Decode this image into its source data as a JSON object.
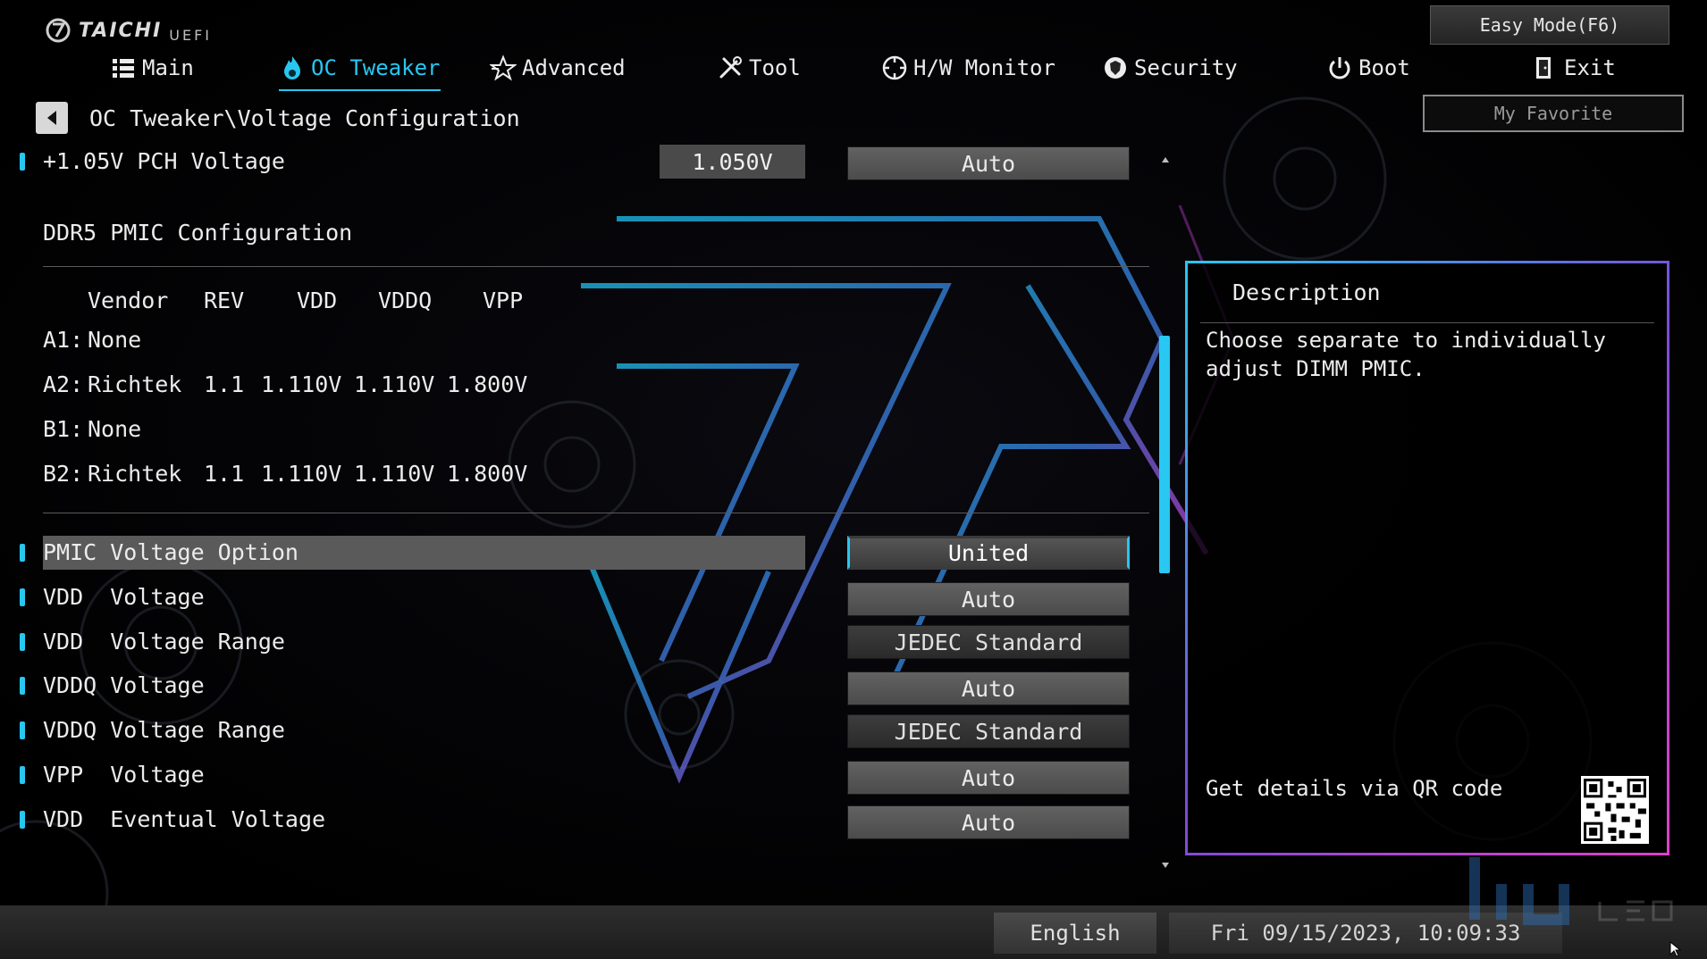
{
  "brand": {
    "name": "TAICHI",
    "sub": "UEFI"
  },
  "header": {
    "easy_mode": "Easy Mode(F6)",
    "my_favorite": "My Favorite"
  },
  "nav": {
    "items": [
      {
        "label": "Main",
        "icon": "list-icon"
      },
      {
        "label": "OC Tweaker",
        "icon": "flame-icon",
        "active": true
      },
      {
        "label": "Advanced",
        "icon": "star-icon"
      },
      {
        "label": "Tool",
        "icon": "tools-icon"
      },
      {
        "label": "H/W Monitor",
        "icon": "monitor-gauge-icon"
      },
      {
        "label": "Security",
        "icon": "shield-icon"
      },
      {
        "label": "Boot",
        "icon": "power-icon"
      },
      {
        "label": "Exit",
        "icon": "exit-door-icon"
      }
    ]
  },
  "breadcrumb": "OC Tweaker\\Voltage Configuration",
  "pch": {
    "label": "+1.05V PCH Voltage",
    "value": "1.050V",
    "option": "Auto"
  },
  "pmic": {
    "section_title": "DDR5 PMIC Configuration",
    "headers": [
      "Vendor",
      "REV",
      "VDD",
      "VDDQ",
      "VPP"
    ],
    "slots": [
      {
        "slot": "A1:",
        "vendor": "None",
        "rev": "",
        "vdd": "",
        "vddq": "",
        "vpp": ""
      },
      {
        "slot": "A2:",
        "vendor": "Richtek",
        "rev": "1.1",
        "vdd": "1.110V",
        "vddq": "1.110V",
        "vpp": "1.800V"
      },
      {
        "slot": "B1:",
        "vendor": "None",
        "rev": "",
        "vdd": "",
        "vddq": "",
        "vpp": ""
      },
      {
        "slot": "B2:",
        "vendor": "Richtek",
        "rev": "1.1",
        "vdd": "1.110V",
        "vddq": "1.110V",
        "vpp": "1.800V"
      }
    ]
  },
  "settings": [
    {
      "label": "PMIC Voltage Option",
      "option": "United",
      "selected": true
    },
    {
      "label": "VDD  Voltage",
      "option": "Auto"
    },
    {
      "label": "VDD  Voltage Range",
      "option": "JEDEC Standard"
    },
    {
      "label": "VDDQ Voltage",
      "option": "Auto"
    },
    {
      "label": "VDDQ Voltage Range",
      "option": "JEDEC Standard"
    },
    {
      "label": "VPP  Voltage",
      "option": "Auto"
    },
    {
      "label": "VDD  Eventual Voltage",
      "option": "Auto"
    }
  ],
  "description": {
    "title": "Description",
    "body": "Choose separate to individually\nadjust DIMM PMIC.",
    "qr_text": "Get details via QR code"
  },
  "status": {
    "language": "English",
    "datetime": "Fri 09/15/2023, 10:09:33"
  },
  "colors": {
    "accent": "#27c7f0",
    "panel_pink": "#e040c8",
    "panel_purple": "#7a4bd8"
  }
}
